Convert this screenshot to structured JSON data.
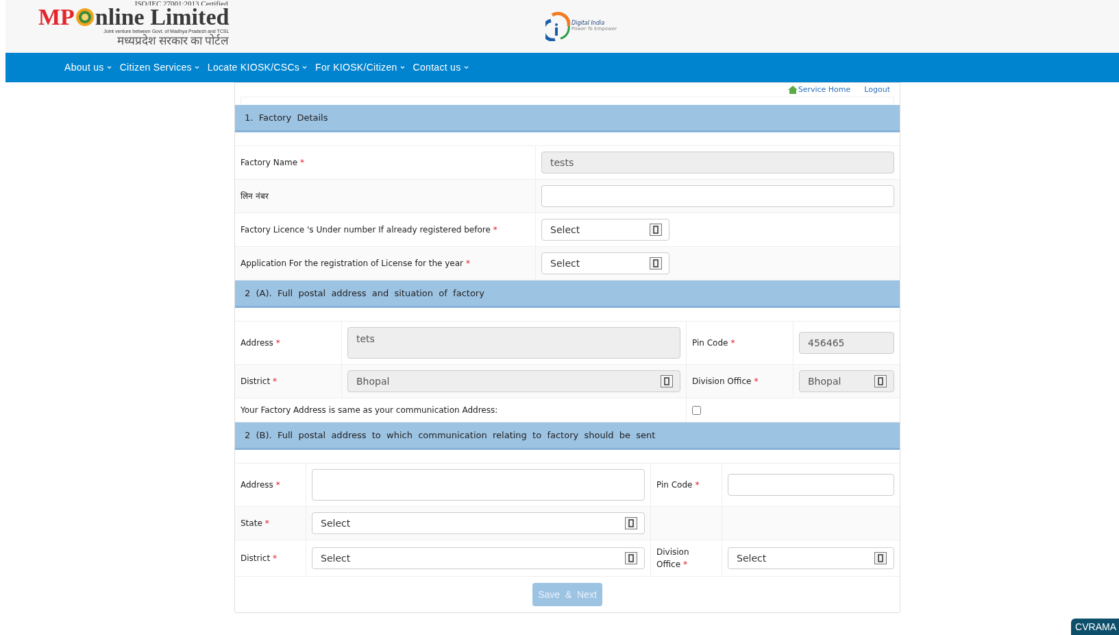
{
  "header": {
    "iso_text": "ISO/IEC 27001:2013 Certified",
    "logo_prefix": "MP",
    "logo_suffix": "nline Limited",
    "logo_subtitle": "Joint venture between Govt. of Madhya Pradesh and TCSL",
    "logo_hindi": "मध्यप्रदेश सरकार का पोर्टल",
    "partner_title": "Digital India",
    "partner_tagline": "Power To Empower"
  },
  "nav": [
    {
      "label": "About us"
    },
    {
      "label": "Citizen Services"
    },
    {
      "label": "Locate KIOSK/CSCs"
    },
    {
      "label": "For KIOSK/Citizen"
    },
    {
      "label": "Contact us"
    }
  ],
  "top_links": [
    {
      "label": "Service Home",
      "icon": true
    },
    {
      "label": "Logout",
      "icon": false
    }
  ],
  "sections": [
    {
      "title": "1.  Factory  Details",
      "kind": "single",
      "rows": [
        {
          "kind": "fields",
          "fields": [
            {
              "label": "Factory Name",
              "required_mark": "*",
              "kind": "text",
              "value": "tests",
              "disabled": true
            }
          ]
        },
        {
          "kind": "fields",
          "fields": [
            {
              "label": "लिन नंबर",
              "kind": "text",
              "disabled": false
            }
          ]
        },
        {
          "kind": "fields",
          "fields": [
            {
              "label": "Factory Licence 's  Under number If already registered before",
              "required_mark": "*",
              "kind": "select",
              "value": "Select",
              "disabled": false
            }
          ]
        },
        {
          "kind": "fields",
          "fields": [
            {
              "label": "Application For the registration of License for the year",
              "required_mark": "*",
              "kind": "select",
              "value": "Select",
              "disabled": false
            }
          ]
        }
      ]
    },
    {
      "title": "2  (A).  Full  postal  address  and  situation  of  factory",
      "kind": "pair-wide",
      "rows": [
        {
          "kind": "fields",
          "fields": [
            {
              "label": "Address",
              "required_mark": "*",
              "kind": "textarea",
              "value": "tets",
              "disabled": true
            },
            {
              "label": "Pin Code",
              "required_mark": "*",
              "kind": "text",
              "value": "456465",
              "disabled": true
            }
          ]
        },
        {
          "kind": "fields",
          "fields": [
            {
              "label": "District",
              "required_mark": "*",
              "kind": "select",
              "value": "Bhopal",
              "disabled": true
            },
            {
              "label": "Division Office",
              "required_mark": "*",
              "kind": "select",
              "value": "Bhopal",
              "disabled": true
            }
          ]
        },
        {
          "kind": "checkbox",
          "label": "Your Factory Address is same as your communication Address:",
          "checked": false
        }
      ]
    },
    {
      "title": "2  (B).  Full  postal  address  to  which  communication  relating  to  factory  should  be  sent",
      "kind": "pair-narrow",
      "rows": [
        {
          "kind": "fields",
          "fields": [
            {
              "label": "Address",
              "required_mark": "*",
              "kind": "textarea",
              "disabled": false
            },
            {
              "label": "Pin Code",
              "required_mark": "*",
              "kind": "text",
              "disabled": false
            }
          ]
        },
        {
          "kind": "fields",
          "fields": [
            {
              "label": "State",
              "required_mark": "*",
              "kind": "select",
              "value": "Select",
              "disabled": false
            }
          ]
        },
        {
          "kind": "fields",
          "fields": [
            {
              "label": "District",
              "required_mark": "*",
              "kind": "select",
              "value": "Select",
              "disabled": false
            },
            {
              "label": "Division Office",
              "required_mark": "*",
              "kind": "select",
              "value": "Select",
              "disabled": false
            }
          ]
        }
      ]
    }
  ],
  "submit": {
    "label": "Save  &  Next",
    "disabled": true
  },
  "chat_badge": "CVRAMA"
}
